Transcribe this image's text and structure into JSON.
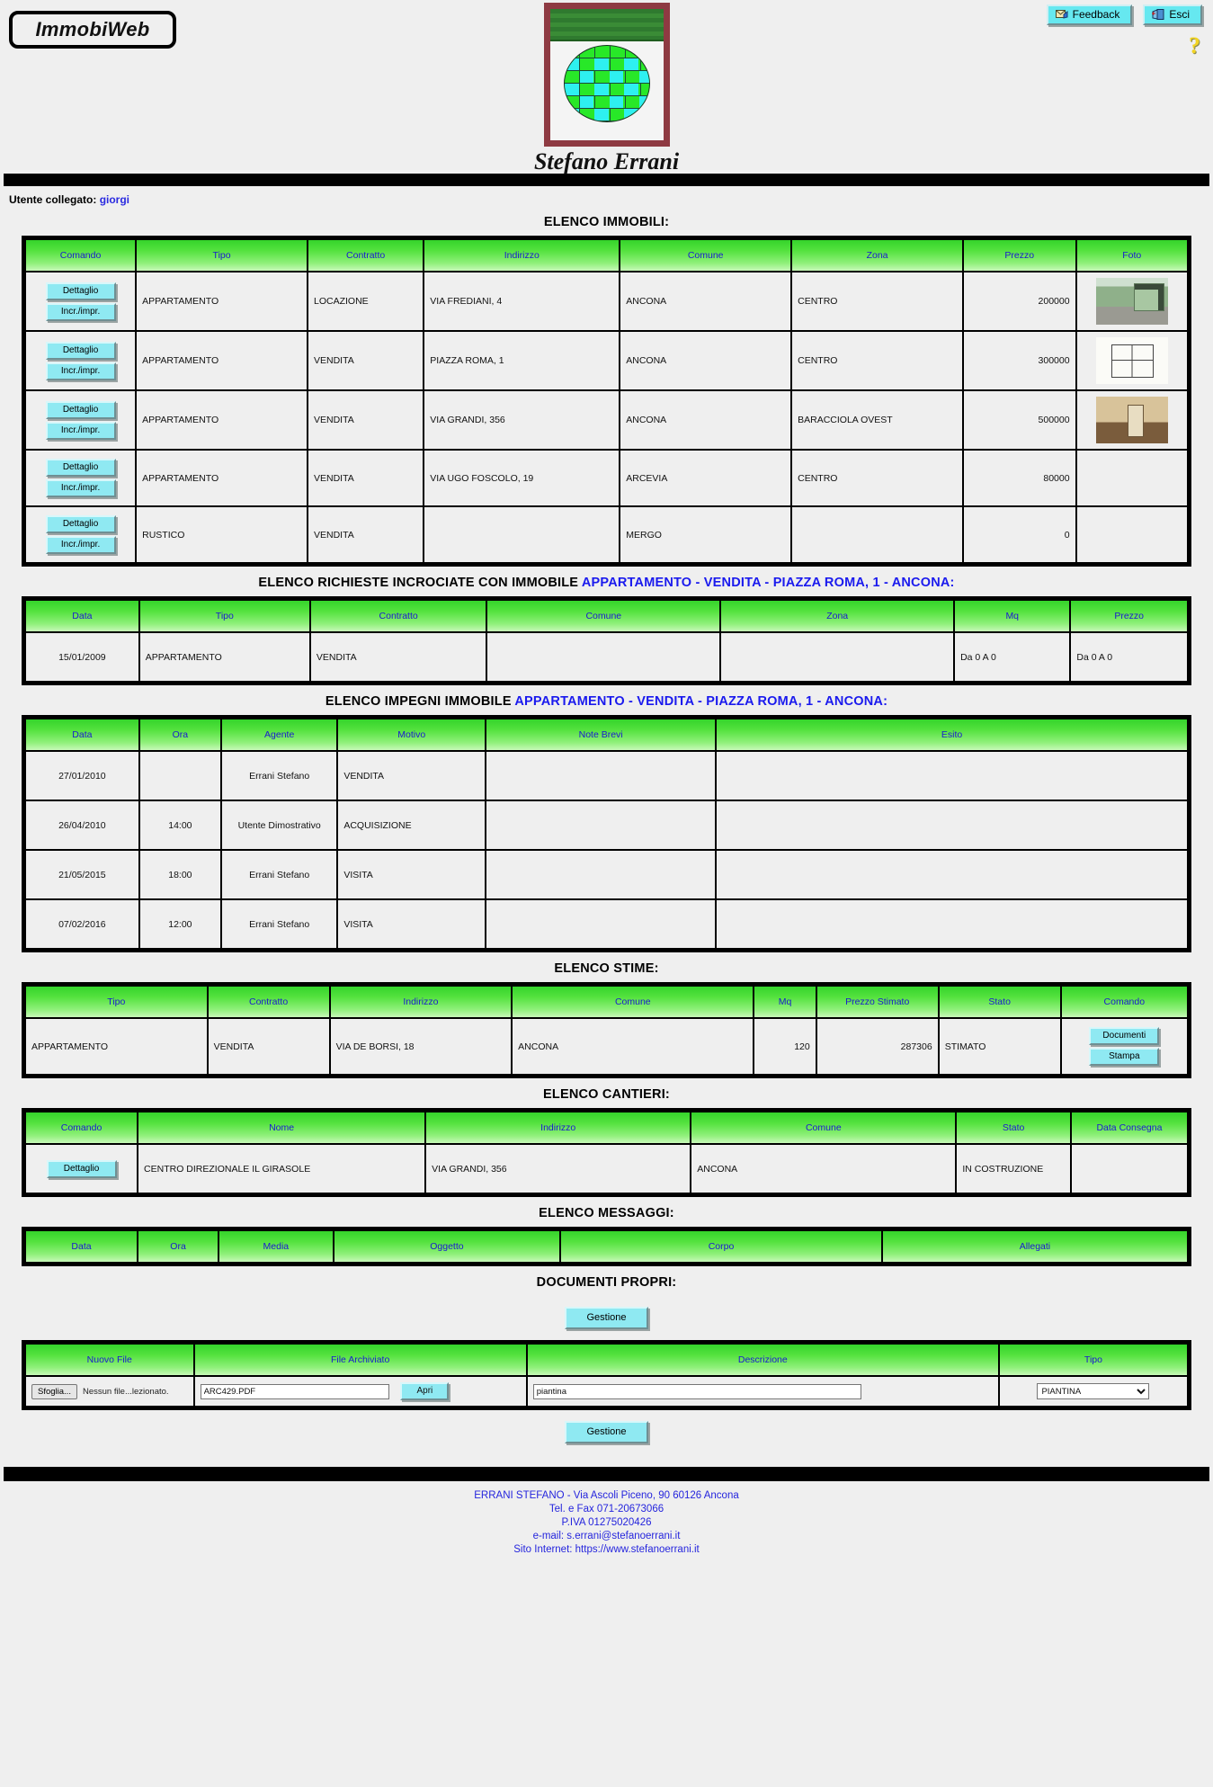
{
  "header": {
    "logo_text": "ImmobiWeb",
    "brand_name": "Stefano Errani",
    "feedback_label": "Feedback",
    "esci_label": "Esci",
    "help_glyph": "?",
    "feedback_icon": "envelope-icon",
    "esci_icon": "exit-door-icon"
  },
  "user": {
    "label": "Utente collegato:",
    "name": "giorgi"
  },
  "immobili": {
    "title": "ELENCO IMMOBILI:",
    "columns": [
      "Comando",
      "Tipo",
      "Contratto",
      "Indirizzo",
      "Comune",
      "Zona",
      "Prezzo",
      "Foto"
    ],
    "buttons": {
      "dettaglio": "Dettaglio",
      "incr": "Incr./impr."
    },
    "rows": [
      {
        "tipo": "APPARTAMENTO",
        "contratto": "LOCAZIONE",
        "indirizzo": "VIA FREDIANI, 4",
        "comune": "ANCONA",
        "zona": "CENTRO",
        "prezzo": "200000",
        "foto": "building-photo"
      },
      {
        "tipo": "APPARTAMENTO",
        "contratto": "VENDITA",
        "indirizzo": "PIAZZA ROMA, 1",
        "comune": "ANCONA",
        "zona": "CENTRO",
        "prezzo": "300000",
        "foto": "floorplan-photo"
      },
      {
        "tipo": "APPARTAMENTO",
        "contratto": "VENDITA",
        "indirizzo": "VIA GRANDI, 356",
        "comune": "ANCONA",
        "zona": "BARACCIOLA OVEST",
        "prezzo": "500000",
        "foto": "interior-photo"
      },
      {
        "tipo": "APPARTAMENTO",
        "contratto": "VENDITA",
        "indirizzo": "VIA UGO FOSCOLO, 19",
        "comune": "ARCEVIA",
        "zona": "CENTRO",
        "prezzo": "80000",
        "foto": ""
      },
      {
        "tipo": "RUSTICO",
        "contratto": "VENDITA",
        "indirizzo": "",
        "comune": "MERGO",
        "zona": "",
        "prezzo": "0",
        "foto": ""
      }
    ]
  },
  "richieste": {
    "title_plain": "ELENCO RICHIESTE INCROCIATE CON IMMOBILE ",
    "title_hl": "APPARTAMENTO - VENDITA - PIAZZA ROMA, 1 - ANCONA:",
    "columns": [
      "Data",
      "Tipo",
      "Contratto",
      "Comune",
      "Zona",
      "Mq",
      "Prezzo"
    ],
    "rows": [
      {
        "data": "15/01/2009",
        "tipo": "APPARTAMENTO",
        "contratto": "VENDITA",
        "comune": "",
        "zona": "",
        "mq": "Da 0 A 0",
        "prezzo": "Da 0 A 0"
      }
    ]
  },
  "impegni": {
    "title_plain": "ELENCO IMPEGNI IMMOBILE ",
    "title_hl": "APPARTAMENTO - VENDITA - PIAZZA ROMA, 1 - ANCONA:",
    "columns": [
      "Data",
      "Ora",
      "Agente",
      "Motivo",
      "Note Brevi",
      "Esito"
    ],
    "rows": [
      {
        "data": "27/01/2010",
        "ora": "",
        "agente": "Errani Stefano",
        "motivo": "VENDITA",
        "note": "",
        "esito": ""
      },
      {
        "data": "26/04/2010",
        "ora": "14:00",
        "agente": "Utente Dimostrativo",
        "motivo": "ACQUISIZIONE",
        "note": "",
        "esito": ""
      },
      {
        "data": "21/05/2015",
        "ora": "18:00",
        "agente": "Errani Stefano",
        "motivo": "VISITA",
        "note": "",
        "esito": ""
      },
      {
        "data": "07/02/2016",
        "ora": "12:00",
        "agente": "Errani Stefano",
        "motivo": "VISITA",
        "note": "",
        "esito": ""
      }
    ]
  },
  "stime": {
    "title": "ELENCO STIME:",
    "columns": [
      "Tipo",
      "Contratto",
      "Indirizzo",
      "Comune",
      "Mq",
      "Prezzo Stimato",
      "Stato",
      "Comando"
    ],
    "buttons": {
      "documenti": "Documenti",
      "stampa": "Stampa"
    },
    "rows": [
      {
        "tipo": "APPARTAMENTO",
        "contratto": "VENDITA",
        "indirizzo": "VIA DE BORSI, 18",
        "comune": "ANCONA",
        "mq": "120",
        "prezzo_stimato": "287306",
        "stato": "STIMATO"
      }
    ]
  },
  "cantieri": {
    "title": "ELENCO CANTIERI:",
    "columns": [
      "Comando",
      "Nome",
      "Indirizzo",
      "Comune",
      "Stato",
      "Data Consegna"
    ],
    "buttons": {
      "dettaglio": "Dettaglio"
    },
    "rows": [
      {
        "nome": "CENTRO DIREZIONALE IL GIRASOLE",
        "indirizzo": "VIA GRANDI, 356",
        "comune": "ANCONA",
        "stato": "IN COSTRUZIONE",
        "data_consegna": ""
      }
    ]
  },
  "messaggi": {
    "title": "ELENCO MESSAGGI:",
    "columns": [
      "Data",
      "Ora",
      "Media",
      "Oggetto",
      "Corpo",
      "Allegati"
    ],
    "rows": []
  },
  "documenti": {
    "title": "DOCUMENTI PROPRI:",
    "gestione_top": "Gestione",
    "gestione_bottom": "Gestione",
    "columns": [
      "Nuovo File",
      "File Archiviato",
      "Descrizione",
      "Tipo"
    ],
    "row": {
      "sfoglia_label": "Sfoglia...",
      "no_file_label": "Nessun file...lezionato.",
      "file_archiviato": "ARC429.PDF",
      "apri_label": "Apri",
      "descrizione": "piantina",
      "tipo_selected": "PIANTINA"
    }
  },
  "footer": {
    "line1": "ERRANI STEFANO - Via Ascoli Piceno, 90 60126 Ancona",
    "line2": "Tel. e Fax 071-20673066",
    "line3": "P.IVA 01275020426",
    "line4": "e-mail: s.errani@stefanoerrani.it",
    "line5": "Sito Internet: https://www.stefanoerrani.it"
  }
}
